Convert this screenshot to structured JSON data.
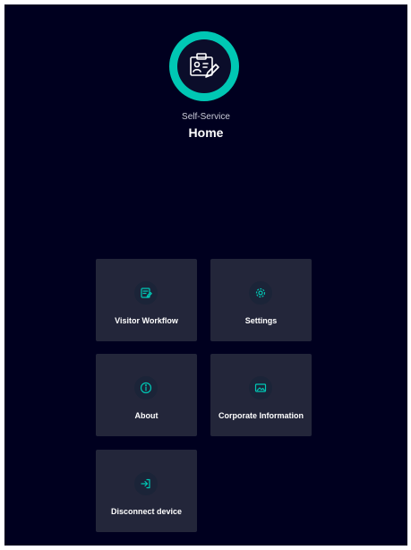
{
  "header": {
    "subtitle": "Self-Service",
    "title": "Home",
    "logo_icon": "visitor-badge-edit-icon"
  },
  "tiles": [
    {
      "label": "Visitor Workflow",
      "icon": "edit-note-icon"
    },
    {
      "label": "Settings",
      "icon": "gear-icon"
    },
    {
      "label": "About",
      "icon": "info-icon"
    },
    {
      "label": "Corporate Information",
      "icon": "image-card-icon"
    },
    {
      "label": "Disconnect device",
      "icon": "logout-icon"
    }
  ],
  "colors": {
    "background": "#00001f",
    "tile": "#23263a",
    "accent": "#00c7b4",
    "text": "#ffffff"
  }
}
